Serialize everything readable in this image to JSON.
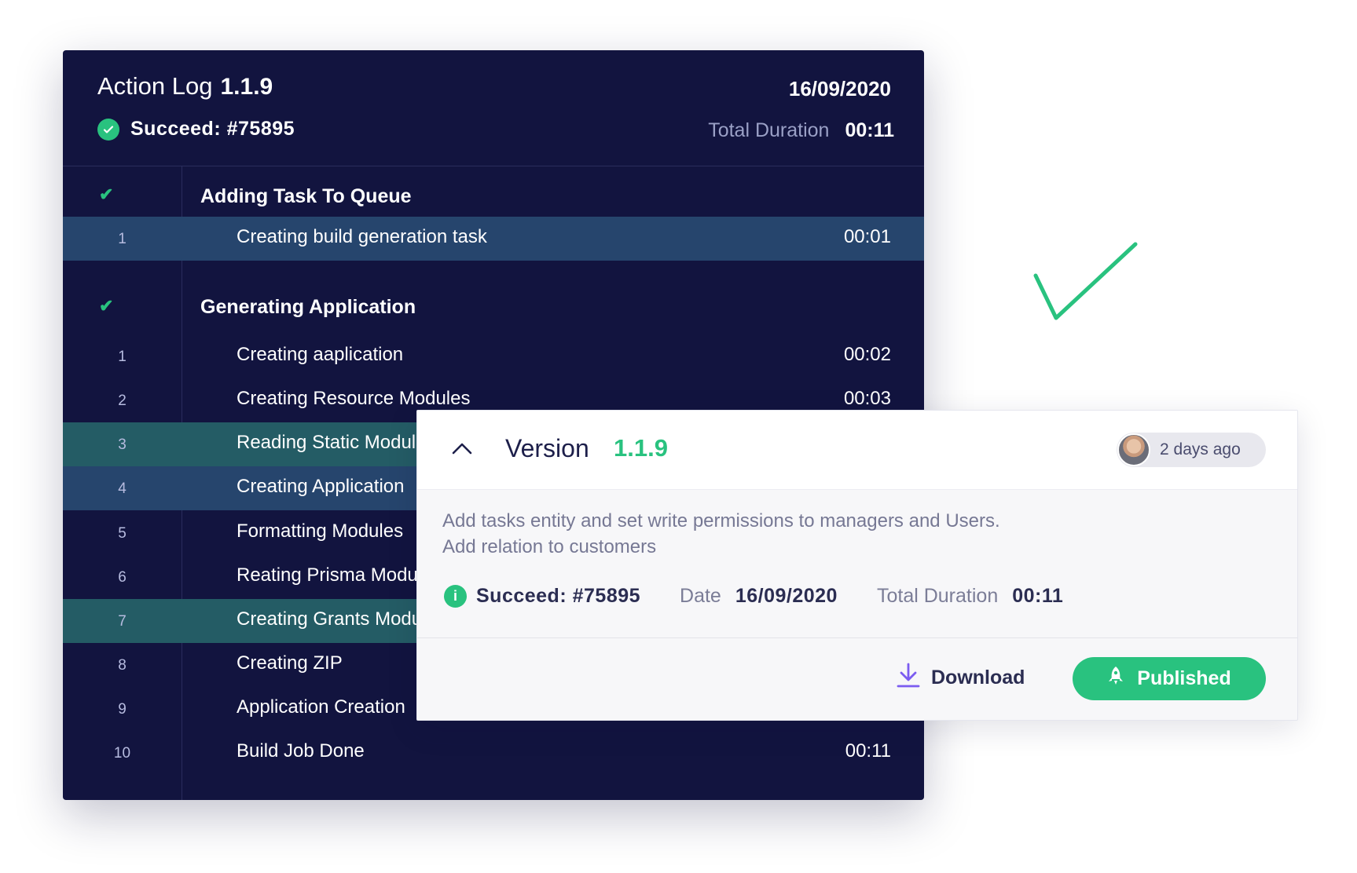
{
  "log": {
    "title": "Action Log",
    "version": "1.1.9",
    "date": "16/09/2020",
    "status": "Succeed: #75895",
    "duration_label": "Total Duration",
    "duration_value": "00:11",
    "sections": [
      {
        "title": "Adding Task To Queue",
        "status_icon": "check-icon",
        "rows": [
          {
            "num": "1",
            "text": "Creating build generation task",
            "time": "00:01",
            "highlight": "blue"
          }
        ]
      },
      {
        "title": "Generating Application",
        "status_icon": "check-icon",
        "rows": [
          {
            "num": "1",
            "text": "Creating aaplication",
            "time": "00:02",
            "highlight": ""
          },
          {
            "num": "2",
            "text": "Creating Resource Modules",
            "time": "00:03",
            "highlight": ""
          },
          {
            "num": "3",
            "text": "Reading Static Modules",
            "time": "",
            "highlight": "teal"
          },
          {
            "num": "4",
            "text": "Creating Application",
            "time": "",
            "highlight": "blue"
          },
          {
            "num": "5",
            "text": "Formatting Modules",
            "time": "",
            "highlight": ""
          },
          {
            "num": "6",
            "text": "Reating Prisma Modules",
            "time": "",
            "highlight": ""
          },
          {
            "num": "7",
            "text": "Creating Grants Modules",
            "time": "",
            "highlight": "teal"
          },
          {
            "num": "8",
            "text": "Creating ZIP",
            "time": "",
            "highlight": ""
          },
          {
            "num": "9",
            "text": "Application Creation",
            "time": "",
            "highlight": ""
          },
          {
            "num": "10",
            "text": "Build Job Done",
            "time": "00:11",
            "highlight": ""
          }
        ]
      }
    ]
  },
  "card": {
    "version_label": "Version",
    "version": "1.1.9",
    "time_ago": "2 days ago",
    "description_line1": "Add tasks entity and set write permissions to managers and Users.",
    "description_line2": "Add relation to customers",
    "status": "Succeed: #75895",
    "date_label": "Date",
    "date_value": "16/09/2020",
    "duration_label": "Total Duration",
    "duration_value": "00:11",
    "download_label": "Download",
    "published_label": "Published"
  },
  "colors": {
    "panel_bg": "#12143f",
    "accent_green": "#29c27f",
    "row_blue": "#26456d",
    "row_teal": "#245c65",
    "download_icon": "#7b5cf0"
  }
}
